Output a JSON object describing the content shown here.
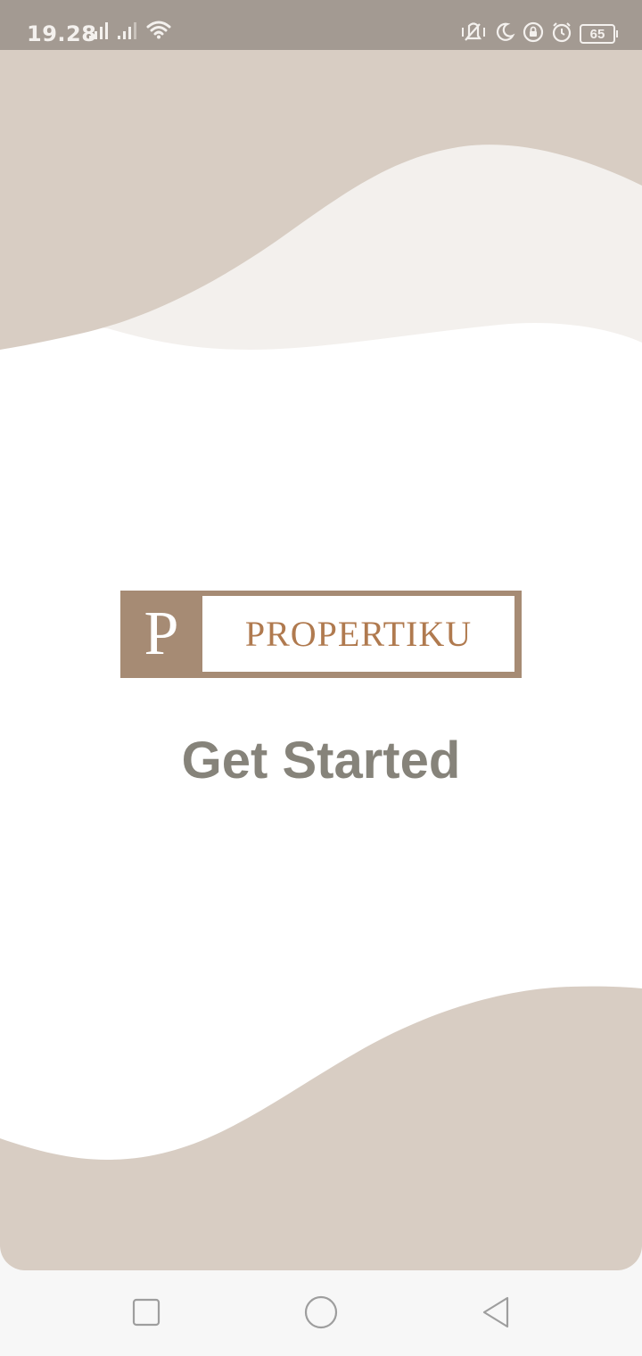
{
  "status_bar": {
    "time": "19.28",
    "battery_level": "65",
    "icons": [
      "signal-icon",
      "signal-icon",
      "wifi-icon",
      "vibrate-icon",
      "do-not-disturb-moon-icon",
      "rotation-lock-icon",
      "alarm-icon",
      "battery-icon"
    ]
  },
  "splash": {
    "logo_letter": "P",
    "logo_text": "PROPERTIKU",
    "get_started": "Get Started"
  },
  "nav_bar": {
    "icons": [
      "recent-apps-square-icon",
      "home-circle-icon",
      "back-triangle-icon"
    ]
  },
  "colors": {
    "status_bar_bg": "#a39a92",
    "wave_dark": "#d8cdc3",
    "wave_light": "#f3f0ed",
    "logo_brown": "#a68b74",
    "logo_text": "#b07a4f",
    "get_started_text": "#86837a"
  }
}
